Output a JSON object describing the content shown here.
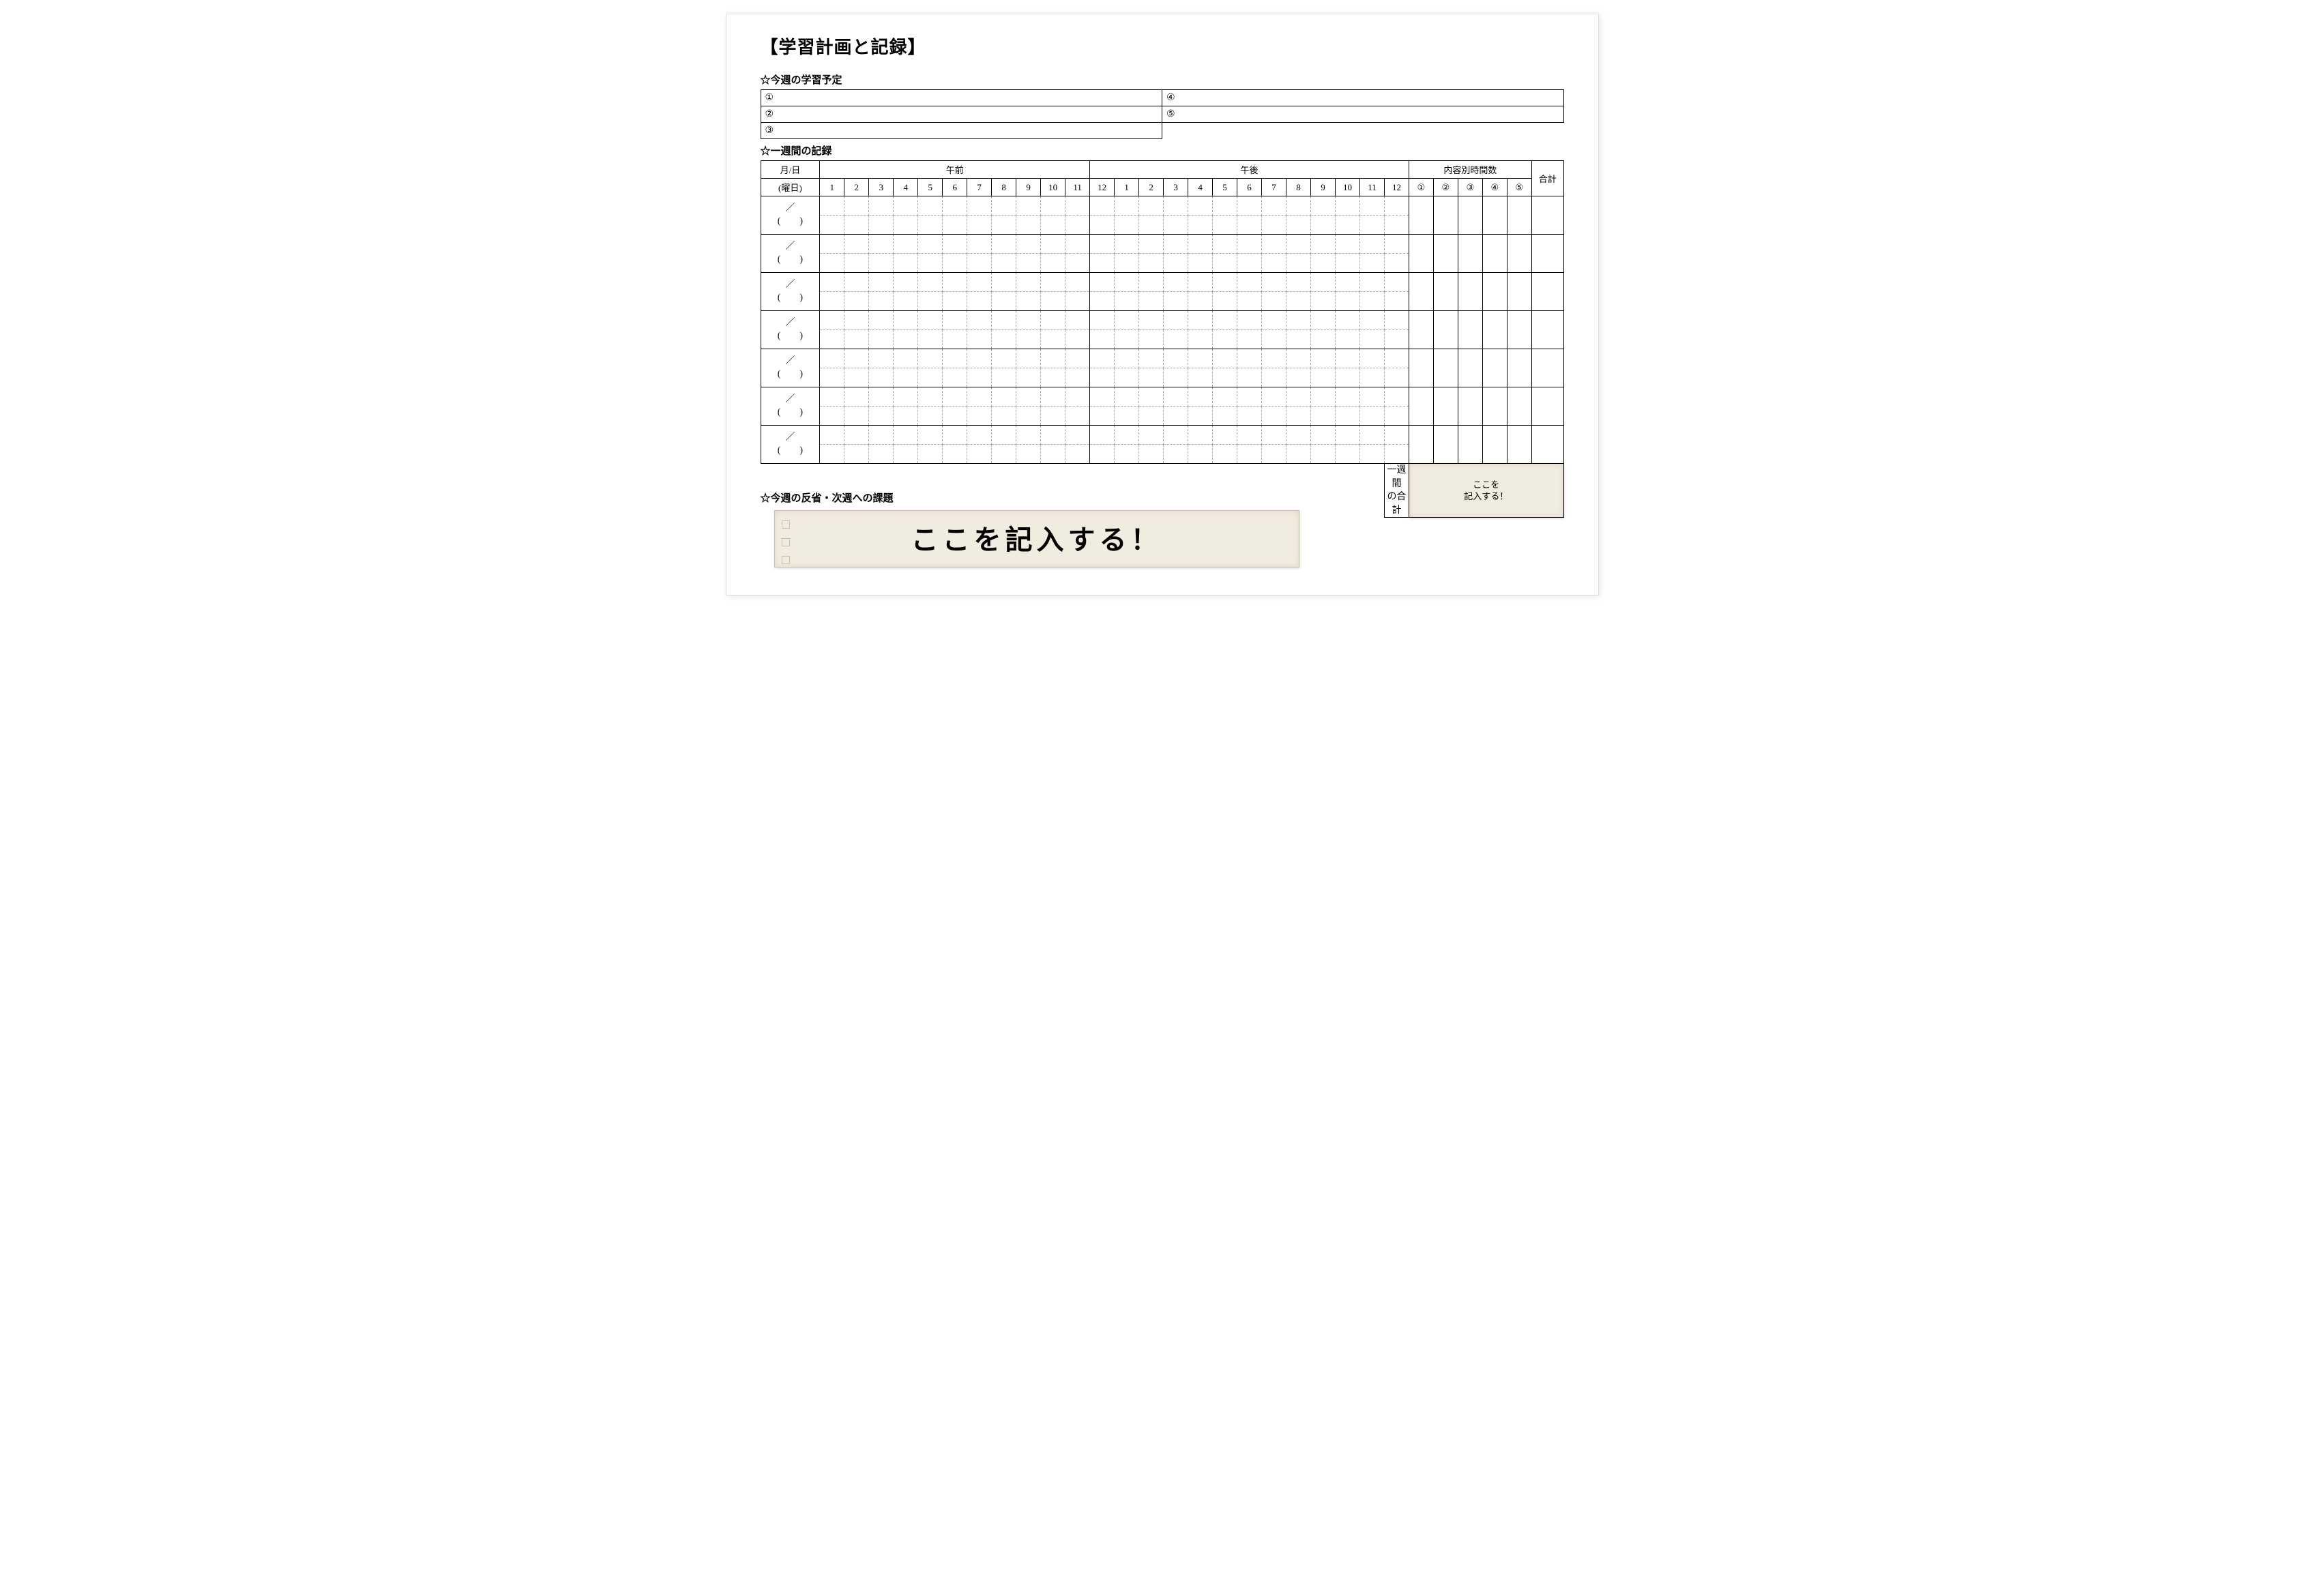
{
  "title": "【学習計画と記録】",
  "sections": {
    "plan_head": "☆今週の学習予定",
    "record_head": "☆一週間の記録",
    "reflection_head": "☆今週の反省・次週への課題"
  },
  "plan": {
    "labels": [
      "①",
      "②",
      "③",
      "④",
      "⑤"
    ]
  },
  "record": {
    "header_date_top": "月/日",
    "header_date_bottom": "(曜日)",
    "header_am": "午前",
    "header_pm": "午後",
    "header_category": "内容別時間数",
    "header_total": "合計",
    "am_hours": [
      "1",
      "2",
      "3",
      "4",
      "5",
      "6",
      "7",
      "8",
      "9",
      "10",
      "11"
    ],
    "pm_hours": [
      "12",
      "1",
      "2",
      "3",
      "4",
      "5",
      "6",
      "7",
      "8",
      "9",
      "10",
      "11",
      "12"
    ],
    "cat_labels": [
      "①",
      "②",
      "③",
      "④",
      "⑤"
    ],
    "day_placeholder_top": "／",
    "day_placeholder_bottom": "(　　)",
    "footer_label_top": "一週間",
    "footer_label_bottom": "の合計"
  },
  "callouts": {
    "small_line1": "ここを",
    "small_line2": "記入する！",
    "big": "ここを記入する！"
  }
}
